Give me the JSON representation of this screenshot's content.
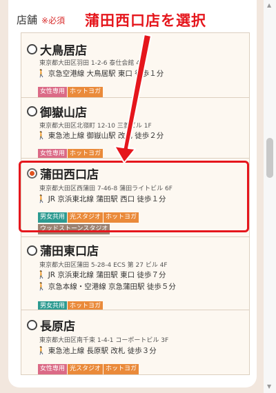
{
  "form": {
    "label": "店舗",
    "required": "※必須"
  },
  "annotation": "蒲田西口店を選択",
  "stores": [
    {
      "name": "大鳥居店",
      "address": "東京都大田区羽田 1-2-6 泰仕会館 4",
      "access": [
        "京急空港線 大鳥居駅 東口 徒歩１分"
      ],
      "tags": [
        "女性専用",
        "ホットヨガ"
      ],
      "selected": false
    },
    {
      "name": "御嶽山店",
      "address": "東京都大田区北嶺町 12-10 三菱ビル 1F",
      "access": [
        "東急池上線 御嶽山駅 改札 徒歩２分"
      ],
      "tags": [
        "女性専用",
        "ホットヨガ"
      ],
      "selected": false
    },
    {
      "name": "蒲田西口店",
      "address": "東京都大田区西蒲田 7-46-8 蒲田ライトビル 6F",
      "access": [
        "JR 京浜東北線 蒲田駅 西口 徒歩１分"
      ],
      "tags": [
        "男女共用",
        "光スタジオ",
        "ホットヨガ",
        "ウッドストーンスタジオ"
      ],
      "selected": true
    },
    {
      "name": "蒲田東口店",
      "address": "東京都大田区蒲田 5-28-4 ECS 第 27 ビル 4F",
      "access": [
        "JR 京浜東北線 蒲田駅 東口 徒歩７分",
        "京急本線・空港線 京急蒲田駅 徒歩５分"
      ],
      "tags": [
        "男女共用",
        "ホットヨガ"
      ],
      "selected": false
    },
    {
      "name": "長原店",
      "address": "東京都大田区南千束 1-4-1 コーポートビル 3F",
      "access": [
        "東急池上線 長原駅 改札 徒歩３分"
      ],
      "tags": [
        "女性専用",
        "光スタジオ",
        "ホットヨガ"
      ],
      "selected": false
    }
  ],
  "colors": {
    "accent_red": "#e5161c",
    "radio_selected": "#e0531f",
    "tag_women": "#db6a86",
    "tag_hot_yoga": "#ea8a3a",
    "tag_unisex": "#2d9b91",
    "tag_woodstone": "#9b8272"
  },
  "icons": {
    "walk": "walking-person-icon"
  }
}
